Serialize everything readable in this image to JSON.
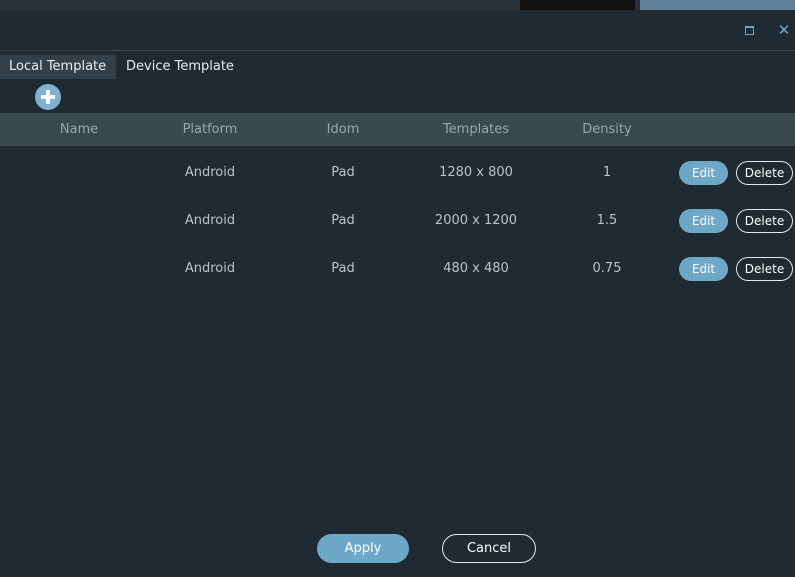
{
  "window": {
    "maximize_icon": "maximize-icon",
    "close_icon": "close-icon",
    "close_glyph": "✕"
  },
  "tabs": [
    {
      "label": "Local Template",
      "active": true
    },
    {
      "label": "Device Template",
      "active": false
    }
  ],
  "add_button": {
    "icon": "plus-icon"
  },
  "table": {
    "columns": [
      "Name",
      "Platform",
      "Idom",
      "Templates",
      "Density"
    ],
    "rows": [
      {
        "name": "",
        "platform": "Android",
        "idom": "Pad",
        "templates": "1280 x 800",
        "density": "1"
      },
      {
        "name": "",
        "platform": "Android",
        "idom": "Pad",
        "templates": "2000 x 1200",
        "density": "1.5"
      },
      {
        "name": "",
        "platform": "Android",
        "idom": "Pad",
        "templates": "480 x 480",
        "density": "0.75"
      }
    ],
    "edit_label": "Edit",
    "delete_label": "Delete"
  },
  "footer": {
    "apply_label": "Apply",
    "cancel_label": "Cancel"
  },
  "colors": {
    "background": "#1f2a33",
    "header": "#3c4850",
    "accent": "#6ea8c9",
    "active_tab": "#33404a"
  }
}
